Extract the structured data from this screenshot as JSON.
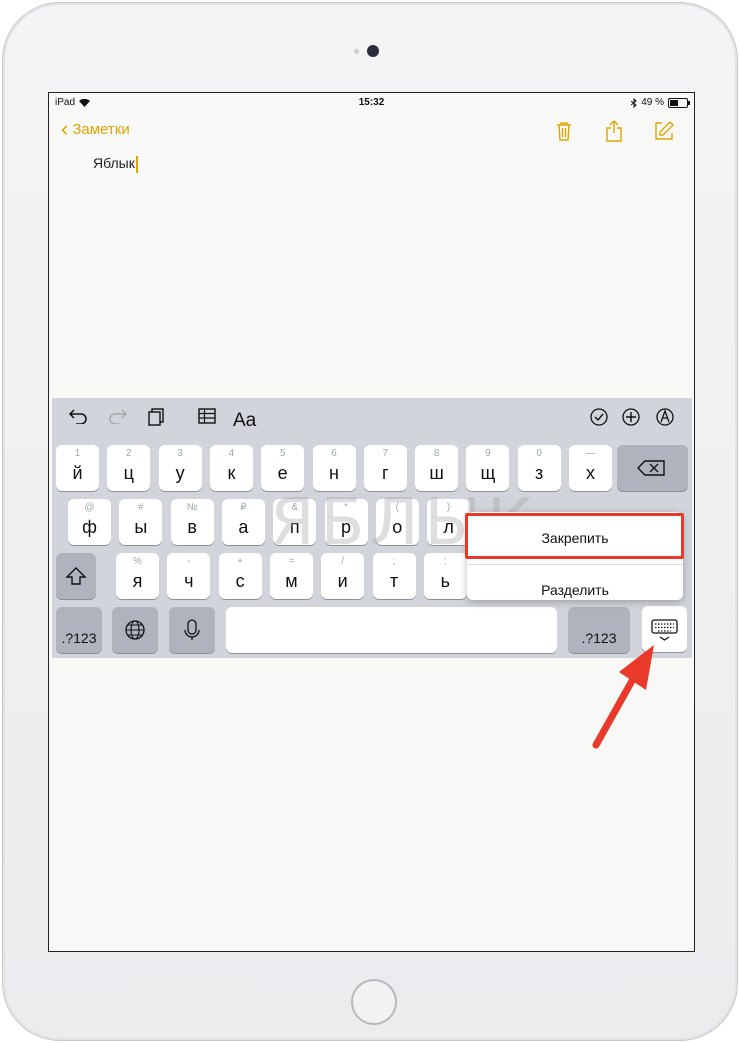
{
  "status": {
    "carrier": "iPad",
    "time": "15:32",
    "battery": "49 %"
  },
  "nav": {
    "back_label": "Заметки"
  },
  "note": {
    "text": "Яблык"
  },
  "keyboard": {
    "row1": [
      {
        "hint": "1",
        "ch": "й"
      },
      {
        "hint": "2",
        "ch": "ц"
      },
      {
        "hint": "3",
        "ch": "у"
      },
      {
        "hint": "4",
        "ch": "к"
      },
      {
        "hint": "5",
        "ch": "е"
      },
      {
        "hint": "6",
        "ch": "н"
      },
      {
        "hint": "7",
        "ch": "г"
      },
      {
        "hint": "8",
        "ch": "ш"
      },
      {
        "hint": "9",
        "ch": "щ"
      },
      {
        "hint": "0",
        "ch": "з"
      },
      {
        "hint": "—",
        "ch": "х"
      }
    ],
    "row2": [
      {
        "hint": "@",
        "ch": "ф"
      },
      {
        "hint": "#",
        "ch": "ы"
      },
      {
        "hint": "№",
        "ch": "в"
      },
      {
        "hint": "₽",
        "ch": "а"
      },
      {
        "hint": "&",
        "ch": "п"
      },
      {
        "hint": "*",
        "ch": "р"
      },
      {
        "hint": "(",
        "ch": "о"
      },
      {
        "hint": ")",
        "ch": "л"
      }
    ],
    "row3": [
      {
        "hint": "%",
        "ch": "я"
      },
      {
        "hint": "-",
        "ch": "ч"
      },
      {
        "hint": "+",
        "ch": "с"
      },
      {
        "hint": "=",
        "ch": "м"
      },
      {
        "hint": "/",
        "ch": "и"
      },
      {
        "hint": ";",
        "ch": "т"
      },
      {
        "hint": ":",
        "ch": "ь"
      }
    ],
    "num_label": ".?123"
  },
  "popup": {
    "pin": "Закрепить",
    "split": "Разделить"
  },
  "watermark": "ЯБЛЫК",
  "colors": {
    "accent": "#e0a500",
    "highlight": "#e8392b"
  }
}
